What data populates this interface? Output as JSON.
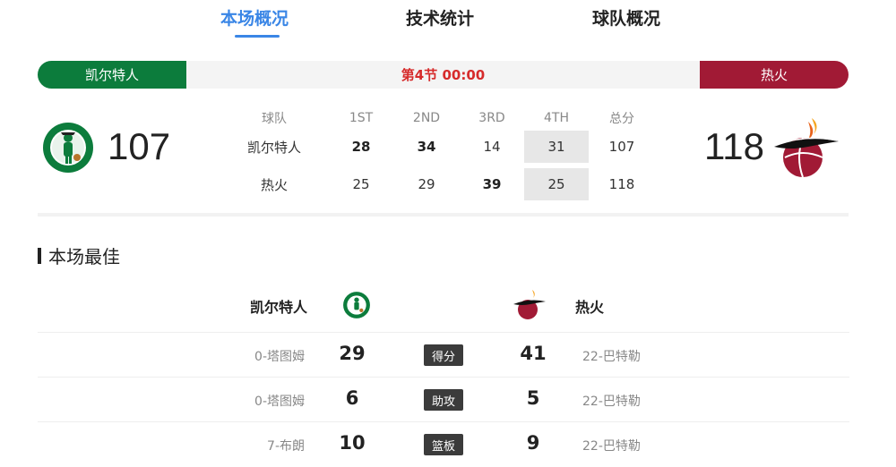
{
  "tabs": [
    {
      "label": "本场概况",
      "active": true
    },
    {
      "label": "技术统计",
      "active": false
    },
    {
      "label": "球队概况",
      "active": false
    }
  ],
  "game": {
    "home_team": "凯尔特人",
    "away_team": "热火",
    "period": "第4节 00:00",
    "home_score": "107",
    "away_score": "118"
  },
  "colors": {
    "accent": "#3a86e6",
    "celtics": "#0c7c3c",
    "heat": "#a11a35",
    "period": "#d62b2b"
  },
  "box_score": {
    "headers": [
      "球队",
      "1ST",
      "2ND",
      "3RD",
      "4TH",
      "总分"
    ],
    "rows": [
      {
        "team": "凯尔特人",
        "q": [
          "28",
          "34",
          "14",
          "31"
        ],
        "total": "107"
      },
      {
        "team": "热火",
        "q": [
          "25",
          "29",
          "39",
          "25"
        ],
        "total": "118"
      }
    ]
  },
  "best": {
    "title": "本场最佳",
    "left_team": "凯尔特人",
    "right_team": "热火",
    "rows": [
      {
        "stat": "得分",
        "left_player": "0-塔图姆",
        "left_value": "29",
        "right_value": "41",
        "right_player": "22-巴特勒"
      },
      {
        "stat": "助攻",
        "left_player": "0-塔图姆",
        "left_value": "6",
        "right_value": "5",
        "right_player": "22-巴特勒"
      },
      {
        "stat": "篮板",
        "left_player": "7-布朗",
        "left_value": "10",
        "right_value": "9",
        "right_player": "22-巴特勒"
      }
    ]
  },
  "icons": {
    "home_logo": "celtics-logo-icon",
    "away_logo": "heat-logo-icon"
  }
}
